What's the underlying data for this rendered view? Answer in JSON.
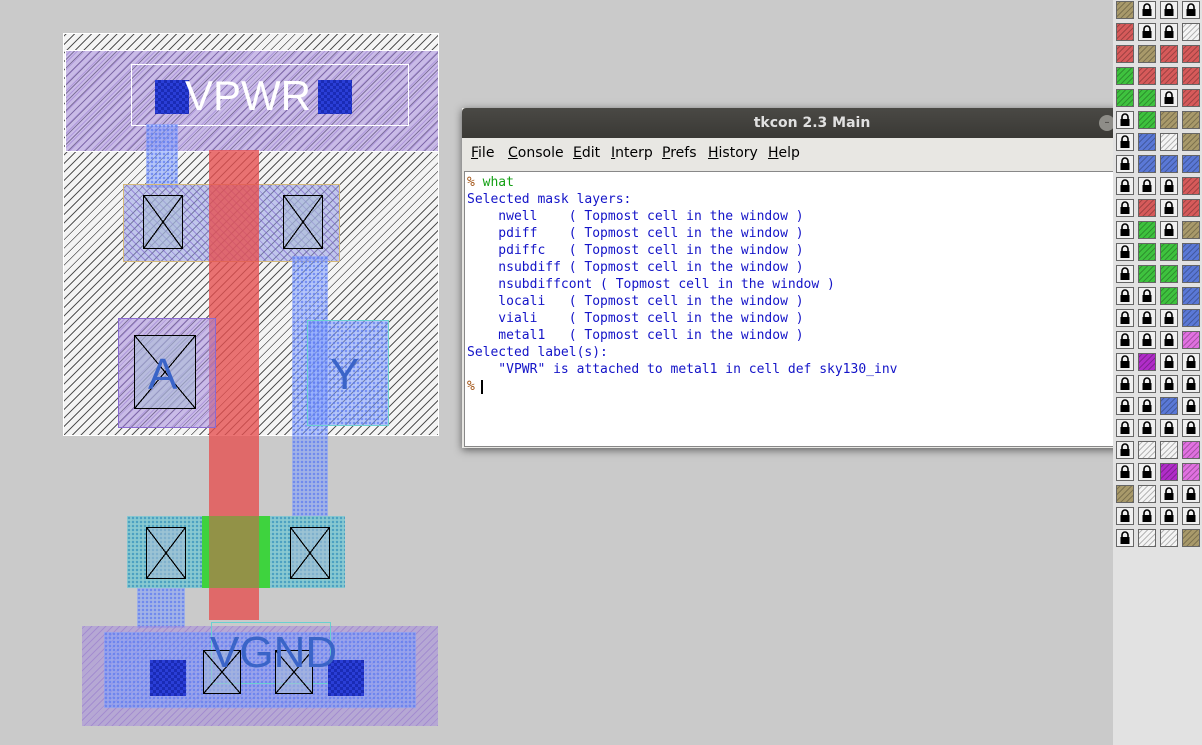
{
  "layout": {
    "labels": {
      "vpwr": "VPWR",
      "vgnd": "VGND",
      "input_a": "A",
      "output_y": "Y"
    }
  },
  "tkcon": {
    "title": "tkcon 2.3 Main",
    "menu": [
      "File",
      "Console",
      "Edit",
      "Interp",
      "Prefs",
      "History",
      "Help"
    ],
    "console_lines": [
      {
        "prompt": "%",
        "text": " what"
      },
      {
        "text": "Selected mask layers:"
      },
      {
        "text": "    nwell    ( Topmost cell in the window )"
      },
      {
        "text": "    pdiff    ( Topmost cell in the window )"
      },
      {
        "text": "    pdiffc   ( Topmost cell in the window )"
      },
      {
        "text": "    nsubdiff ( Topmost cell in the window )"
      },
      {
        "text": "    nsubdiffcont ( Topmost cell in the window )"
      },
      {
        "text": "    locali   ( Topmost cell in the window )"
      },
      {
        "text": "    viali    ( Topmost cell in the window )"
      },
      {
        "text": "    metal1   ( Topmost cell in the window )"
      },
      {
        "text": "Selected label(s):"
      },
      {
        "text": "    \"VPWR\" is attached to metal1 in cell def sky130_inv"
      },
      {
        "prompt": "%",
        "text": ""
      }
    ],
    "window_buttons": [
      "minimize-icon",
      "maximize-icon",
      "close-icon"
    ]
  },
  "palette": {
    "colors": {
      "tan": "#a8996a",
      "red": "#d65a5a",
      "green": "#3ec23e",
      "blue": "#5a78d6",
      "purple": "#b02cc8",
      "pink": "#e070e0",
      "lock": "#000000"
    }
  }
}
